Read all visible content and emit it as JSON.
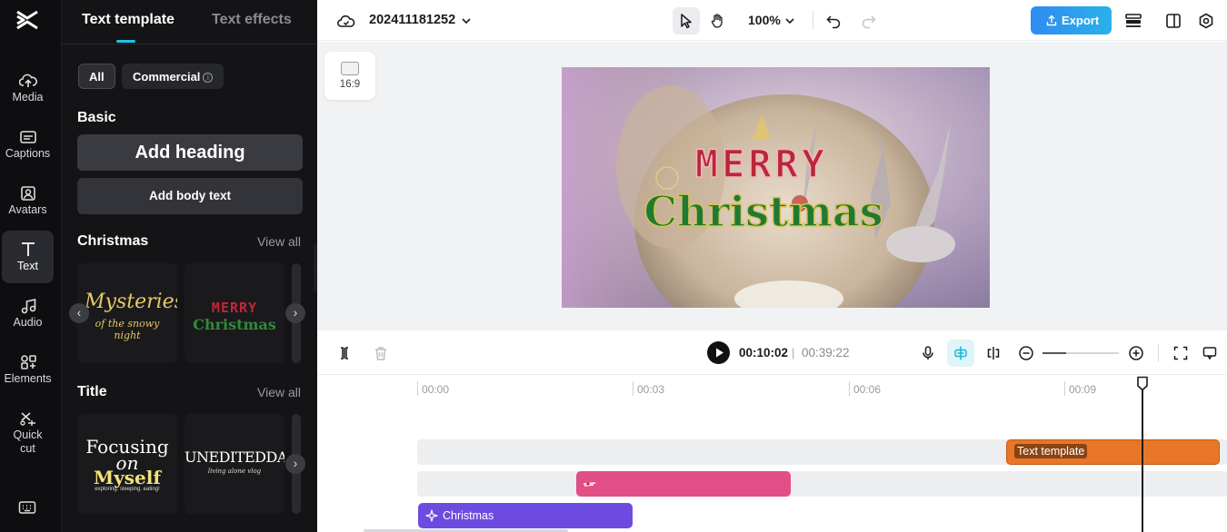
{
  "rail": {
    "items": [
      {
        "label": "Media",
        "icon": "cloud-upload-icon"
      },
      {
        "label": "Captions",
        "icon": "captions-icon"
      },
      {
        "label": "Avatars",
        "icon": "avatar-icon"
      },
      {
        "label": "Text",
        "icon": "text-icon",
        "active": true
      },
      {
        "label": "Audio",
        "icon": "music-note-icon"
      },
      {
        "label": "Elements",
        "icon": "elements-icon"
      },
      {
        "label": "Quick",
        "label2": "cut",
        "icon": "quick-cut-icon"
      }
    ]
  },
  "panel": {
    "tabs": [
      "Text template",
      "Text effects"
    ],
    "filters": {
      "all": "All",
      "commercial": "Commercial",
      "info_glyph": "i"
    },
    "basic": {
      "title": "Basic",
      "heading_btn": "Add heading",
      "body_btn": "Add body text"
    },
    "christmas": {
      "title": "Christmas",
      "view_all": "View all",
      "cards": [
        {
          "line1": "Mysteries",
          "line2": "of the snowy night"
        },
        {
          "line1": "MERRY",
          "line2": "Christmas"
        }
      ]
    },
    "title_section": {
      "title": "Title",
      "view_all": "View all",
      "cards": [
        {
          "line1": "Focusing",
          "line2": "on",
          "line3": "Myself",
          "line4": "exploring. sleeping. eating!"
        },
        {
          "line1": "UNEDITEDDAY",
          "line2": "living alone vlog"
        }
      ]
    }
  },
  "topbar": {
    "project_name": "202411181252",
    "zoom": "100%",
    "export_label": "Export"
  },
  "stage": {
    "ratio_label": "16:9",
    "video_text": {
      "line1": "MERRY",
      "line2": "Christmas"
    }
  },
  "timeline_controls": {
    "current_time": "00:10:02",
    "separator": "|",
    "total_time": "00:39:22"
  },
  "timeline": {
    "ruler": [
      "00:00",
      "00:03",
      "00:06",
      "00:09"
    ],
    "clips": {
      "text_template": "Text template",
      "christmas": "Christmas"
    }
  },
  "colors": {
    "accent": "#22c3e6",
    "export": "#2f8bf0",
    "text_clip": "#e87628",
    "pink_clip": "#e24e86",
    "purple_clip": "#6e4be0"
  }
}
